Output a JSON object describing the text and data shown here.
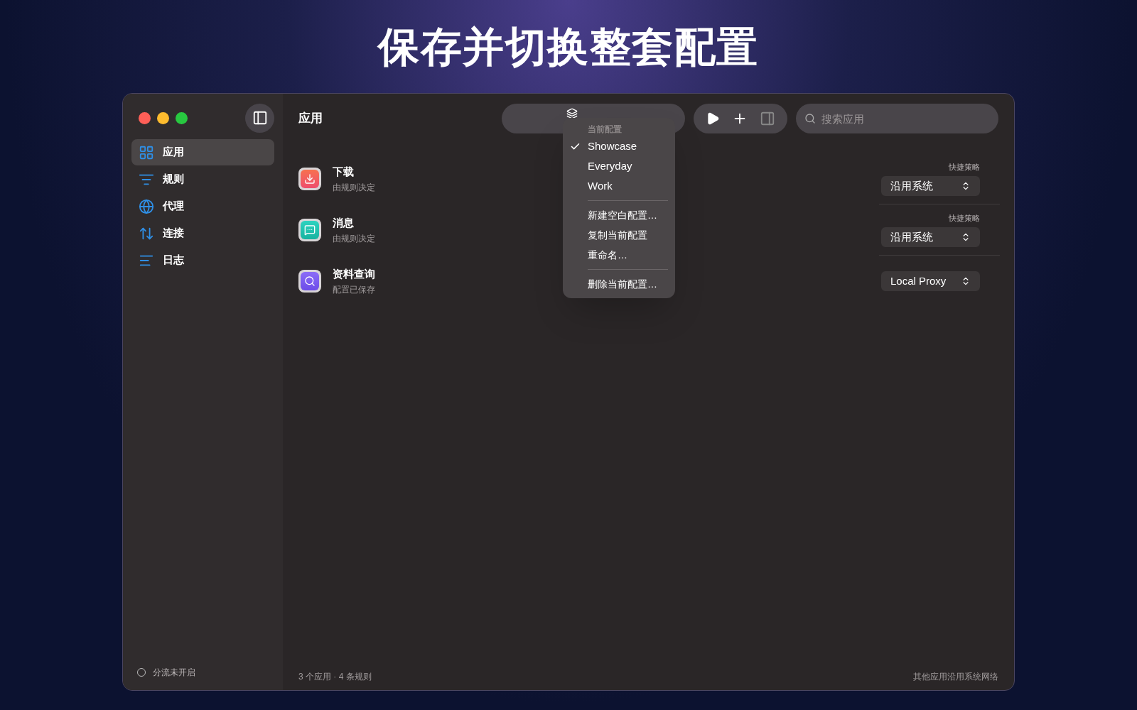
{
  "headline": "保存并切换整套配置",
  "sidebar": {
    "items": [
      {
        "label": "应用",
        "kind": "grid",
        "selected": true
      },
      {
        "label": "规则",
        "kind": "filter",
        "selected": false
      },
      {
        "label": "代理",
        "kind": "globe",
        "selected": false
      },
      {
        "label": "连接",
        "kind": "arrows",
        "selected": false
      },
      {
        "label": "日志",
        "kind": "log",
        "selected": false
      }
    ],
    "status": "分流未开启"
  },
  "toolbar": {
    "title": "应用",
    "search": {
      "placeholder": "搜索应用"
    }
  },
  "profile_menu": {
    "header": "当前配置",
    "profiles": [
      {
        "label": "Showcase",
        "selected": true
      },
      {
        "label": "Everyday",
        "selected": false
      },
      {
        "label": "Work",
        "selected": false
      }
    ],
    "action_groups": [
      [
        "新建空白配置…",
        "复制当前配置",
        "重命名…"
      ],
      [
        "删除当前配置…"
      ]
    ]
  },
  "apps": [
    {
      "name": "下载",
      "subtitle": "由规则决定",
      "kind": "download",
      "policy_label": "快捷策略",
      "policy": "沿用系统"
    },
    {
      "name": "消息",
      "subtitle": "由规则决定",
      "kind": "message",
      "policy_label": "快捷策略",
      "policy": "沿用系统"
    },
    {
      "name": "资料查询",
      "subtitle": "配置已保存",
      "kind": "search",
      "policy": "Local Proxy"
    }
  ],
  "footer": {
    "summary": "3 个应用 · 4 条规则",
    "note": "其他应用沿用系统网络"
  }
}
